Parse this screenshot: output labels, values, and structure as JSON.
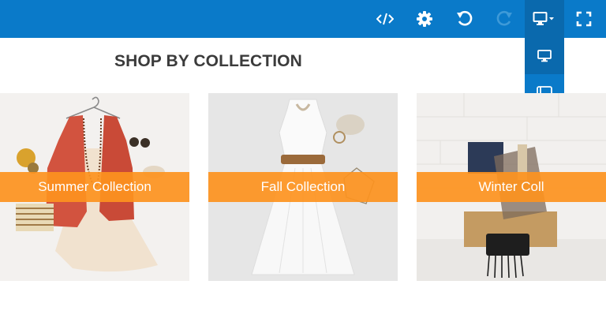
{
  "toolbar": {
    "buttons": [
      {
        "id": "code",
        "icon": "code-icon"
      },
      {
        "id": "settings",
        "icon": "gear-icon"
      },
      {
        "id": "undo",
        "icon": "undo-icon"
      },
      {
        "id": "redo",
        "icon": "redo-icon",
        "disabled": true
      },
      {
        "id": "device",
        "icon": "monitor-dropdown-icon"
      },
      {
        "id": "fullscreen",
        "icon": "fullscreen-icon"
      }
    ],
    "colors": {
      "bar": "#0a7ac9",
      "active": "#0a69ad",
      "icon": "#ffffff",
      "disabled_icon": "#3e9ad8"
    }
  },
  "device_menu": {
    "items": [
      {
        "icon": "desktop-icon",
        "active": true
      },
      {
        "icon": "tablet-landscape-icon",
        "active": false
      },
      {
        "icon": "tablet-portrait-icon",
        "active": false
      },
      {
        "icon": "mobile-landscape-icon",
        "active": false
      },
      {
        "icon": "mobile-portrait-icon",
        "active": false
      }
    ]
  },
  "content": {
    "section_title": "SHOP BY COLLECTION",
    "collections": [
      {
        "label": "Summer Collection"
      },
      {
        "label": "Fall Collection"
      },
      {
        "label": "Winter Coll"
      }
    ],
    "banner_color": "#fd931e"
  }
}
